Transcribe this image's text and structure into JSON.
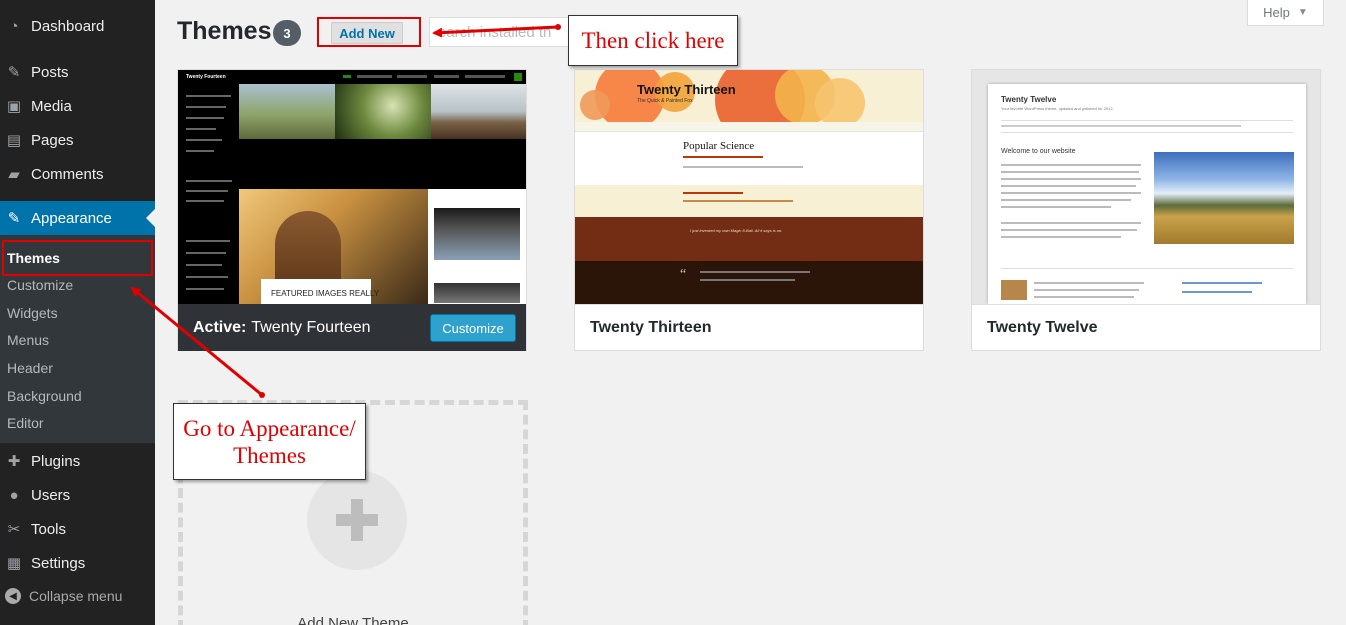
{
  "sidebar": {
    "items": [
      {
        "label": "Dashboard",
        "icon": "dashboard-icon",
        "glyph": "◔"
      },
      {
        "label": "Posts",
        "icon": "pin-icon",
        "glyph": "✎"
      },
      {
        "label": "Media",
        "icon": "media-icon",
        "glyph": "▣"
      },
      {
        "label": "Pages",
        "icon": "pages-icon",
        "glyph": "▤"
      },
      {
        "label": "Comments",
        "icon": "comment-icon",
        "glyph": "▰"
      },
      {
        "label": "Appearance",
        "icon": "paintbrush-icon",
        "glyph": "✎"
      },
      {
        "label": "Plugins",
        "icon": "plugin-icon",
        "glyph": "✚"
      },
      {
        "label": "Users",
        "icon": "user-icon",
        "glyph": "●"
      },
      {
        "label": "Tools",
        "icon": "wrench-icon",
        "glyph": "✂"
      },
      {
        "label": "Settings",
        "icon": "settings-icon",
        "glyph": "▦"
      }
    ],
    "submenu": [
      "Themes",
      "Customize",
      "Widgets",
      "Menus",
      "Header",
      "Background",
      "Editor"
    ],
    "collapse_label": "Collapse menu"
  },
  "header": {
    "title": "Themes",
    "count": "3",
    "add_new_label": "Add New",
    "search_placeholder": "earch installed th",
    "help_label": "Help"
  },
  "themes": [
    {
      "name": "Twenty Fourteen",
      "active_prefix": "Active:",
      "customize_label": "Customize"
    },
    {
      "name": "Twenty Thirteen"
    },
    {
      "name": "Twenty Twelve"
    }
  ],
  "screenshots": {
    "t14_title": "Twenty Fourteen",
    "t14_featured": "FEATURED IMAGES REALLY",
    "t13_title": "Twenty Thirteen",
    "t13_tagline": "The Quick & Painted Fox",
    "t13_post": "Popular Science",
    "t13_quote": "I just invented my own Magic 8-Ball. All it says is no.",
    "t12_title": "Twenty Twelve",
    "t12_tagline": "Your favorite WordPress theme, updated and polished for 2012.",
    "t12_welcome": "Welcome to our website"
  },
  "add_new_theme_label": "Add New Theme",
  "annotations": {
    "then_click": "Then click here",
    "go_to_line1": "Go to Appearance/",
    "go_to_line2": "Themes"
  },
  "colors": {
    "accent": "#0073aa",
    "annotation": "#e00000",
    "sidebar": "#222222"
  }
}
